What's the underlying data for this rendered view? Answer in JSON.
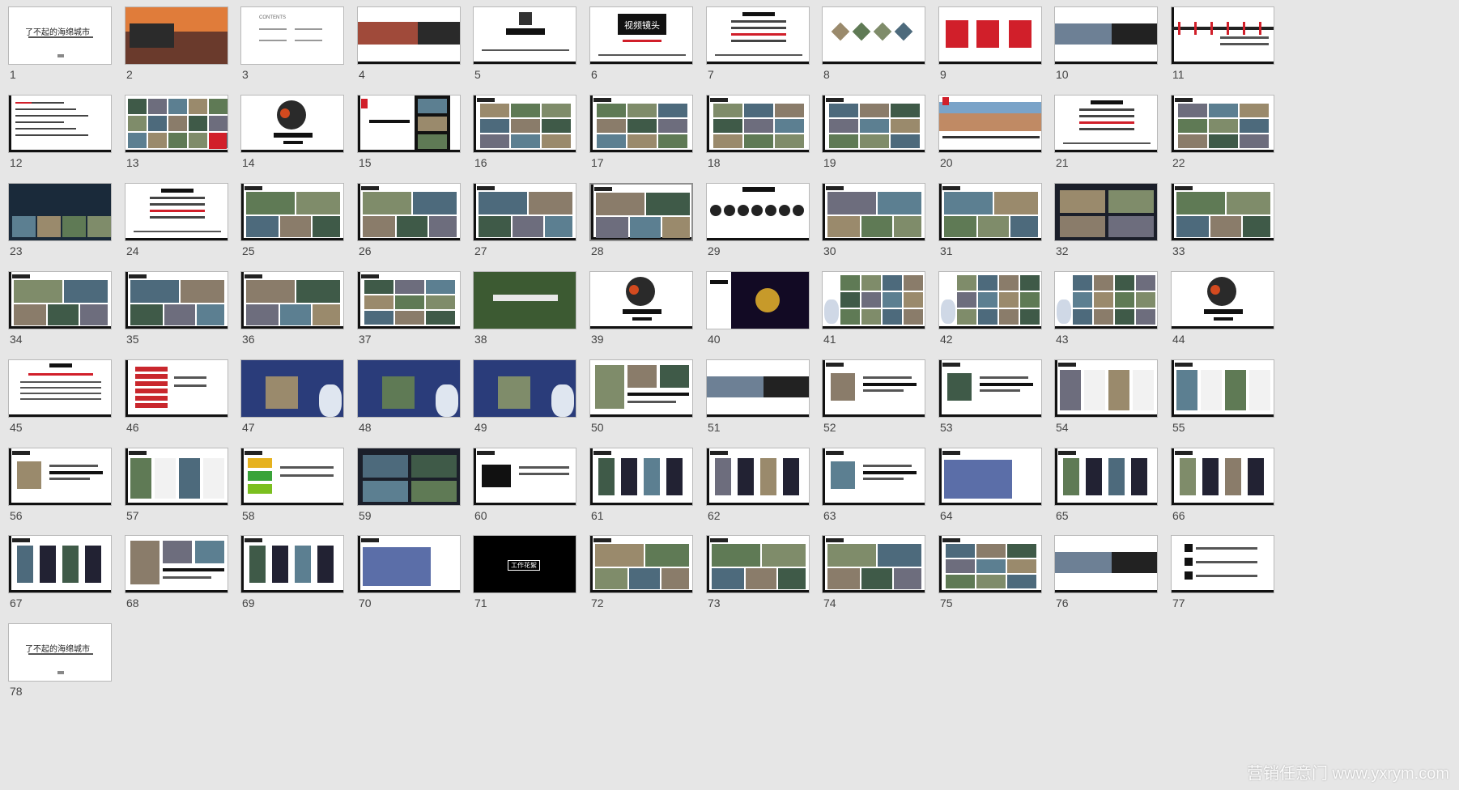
{
  "slides": [
    {
      "n": "1",
      "t": "title",
      "caption": "了不起的海绵城市"
    },
    {
      "n": "2",
      "t": "photo_dark",
      "caption": ""
    },
    {
      "n": "3",
      "t": "contents",
      "caption": "CONTENTS"
    },
    {
      "n": "4",
      "t": "banner",
      "caption": ""
    },
    {
      "n": "5",
      "t": "center",
      "caption": ""
    },
    {
      "n": "6",
      "t": "center_title",
      "caption": "视频镜头"
    },
    {
      "n": "7",
      "t": "center_list",
      "caption": ""
    },
    {
      "n": "8",
      "t": "diamonds",
      "caption": ""
    },
    {
      "n": "9",
      "t": "red_boxes",
      "caption": ""
    },
    {
      "n": "10",
      "t": "banner_dark",
      "caption": ""
    },
    {
      "n": "11",
      "t": "timeline",
      "caption": ""
    },
    {
      "n": "12",
      "t": "text",
      "caption": ""
    },
    {
      "n": "13",
      "t": "collage",
      "caption": ""
    },
    {
      "n": "14",
      "t": "circle",
      "caption": ""
    },
    {
      "n": "15",
      "t": "film",
      "caption": ""
    },
    {
      "n": "16",
      "t": "grid6",
      "caption": ""
    },
    {
      "n": "17",
      "t": "grid6",
      "caption": ""
    },
    {
      "n": "18",
      "t": "grid6",
      "caption": ""
    },
    {
      "n": "19",
      "t": "grid6",
      "caption": ""
    },
    {
      "n": "20",
      "t": "pano",
      "caption": ""
    },
    {
      "n": "21",
      "t": "center_list",
      "caption": ""
    },
    {
      "n": "22",
      "t": "grid6",
      "caption": ""
    },
    {
      "n": "23",
      "t": "collage_dark",
      "caption": ""
    },
    {
      "n": "24",
      "t": "center_list",
      "caption": ""
    },
    {
      "n": "25",
      "t": "grid4",
      "caption": ""
    },
    {
      "n": "26",
      "t": "grid4",
      "caption": ""
    },
    {
      "n": "27",
      "t": "grid4",
      "caption": ""
    },
    {
      "n": "28",
      "t": "grid4",
      "caption": ""
    },
    {
      "n": "29",
      "t": "circles_row",
      "caption": ""
    },
    {
      "n": "30",
      "t": "grid4",
      "caption": ""
    },
    {
      "n": "31",
      "t": "grid4",
      "caption": ""
    },
    {
      "n": "32",
      "t": "grid4_dark",
      "caption": ""
    },
    {
      "n": "33",
      "t": "grid4",
      "caption": ""
    },
    {
      "n": "34",
      "t": "grid4",
      "caption": ""
    },
    {
      "n": "35",
      "t": "grid4",
      "caption": ""
    },
    {
      "n": "36",
      "t": "grid4",
      "caption": ""
    },
    {
      "n": "37",
      "t": "grid6",
      "caption": ""
    },
    {
      "n": "38",
      "t": "photo_full",
      "caption": ""
    },
    {
      "n": "39",
      "t": "circle",
      "caption": ""
    },
    {
      "n": "40",
      "t": "neon",
      "caption": ""
    },
    {
      "n": "41",
      "t": "robot_collage",
      "caption": ""
    },
    {
      "n": "42",
      "t": "robot_collage",
      "caption": ""
    },
    {
      "n": "43",
      "t": "robot_collage",
      "caption": ""
    },
    {
      "n": "44",
      "t": "circle",
      "caption": ""
    },
    {
      "n": "45",
      "t": "text_center",
      "caption": ""
    },
    {
      "n": "46",
      "t": "red_list",
      "caption": ""
    },
    {
      "n": "47",
      "t": "robot_photo",
      "caption": ""
    },
    {
      "n": "48",
      "t": "robot_photo",
      "caption": ""
    },
    {
      "n": "49",
      "t": "robot_photo",
      "caption": ""
    },
    {
      "n": "50",
      "t": "photos_text",
      "caption": ""
    },
    {
      "n": "51",
      "t": "banner_dark",
      "caption": ""
    },
    {
      "n": "52",
      "t": "text_img",
      "caption": ""
    },
    {
      "n": "53",
      "t": "text_img",
      "caption": ""
    },
    {
      "n": "54",
      "t": "screens",
      "caption": ""
    },
    {
      "n": "55",
      "t": "screens",
      "caption": ""
    },
    {
      "n": "56",
      "t": "text_img",
      "caption": ""
    },
    {
      "n": "57",
      "t": "screens",
      "caption": ""
    },
    {
      "n": "58",
      "t": "logos",
      "caption": ""
    },
    {
      "n": "59",
      "t": "grid4_dark",
      "caption": ""
    },
    {
      "n": "60",
      "t": "tiktok",
      "caption": ""
    },
    {
      "n": "61",
      "t": "phones",
      "caption": ""
    },
    {
      "n": "62",
      "t": "phones",
      "caption": ""
    },
    {
      "n": "63",
      "t": "text_img",
      "caption": ""
    },
    {
      "n": "64",
      "t": "photo_stage",
      "caption": ""
    },
    {
      "n": "65",
      "t": "phones",
      "caption": ""
    },
    {
      "n": "66",
      "t": "phones",
      "caption": ""
    },
    {
      "n": "67",
      "t": "phones",
      "caption": ""
    },
    {
      "n": "68",
      "t": "photos_text",
      "caption": ""
    },
    {
      "n": "69",
      "t": "phones",
      "caption": ""
    },
    {
      "n": "70",
      "t": "photo_stage",
      "caption": ""
    },
    {
      "n": "71",
      "t": "black",
      "caption": "工作花絮"
    },
    {
      "n": "72",
      "t": "grid4",
      "caption": ""
    },
    {
      "n": "73",
      "t": "grid4",
      "caption": ""
    },
    {
      "n": "74",
      "t": "grid4",
      "caption": ""
    },
    {
      "n": "75",
      "t": "grid6",
      "caption": ""
    },
    {
      "n": "76",
      "t": "banner_dark",
      "caption": ""
    },
    {
      "n": "77",
      "t": "list_icons",
      "caption": ""
    },
    {
      "n": "78",
      "t": "title",
      "caption": "了不起的海绵城市"
    }
  ],
  "selected_slide": "28",
  "watermark": "营销任意门 www.yxrym.com",
  "colors": {
    "bg": "#e6e6e6",
    "accent": "#d11f2a",
    "dark": "#111111",
    "photo": "#6d7b62"
  }
}
